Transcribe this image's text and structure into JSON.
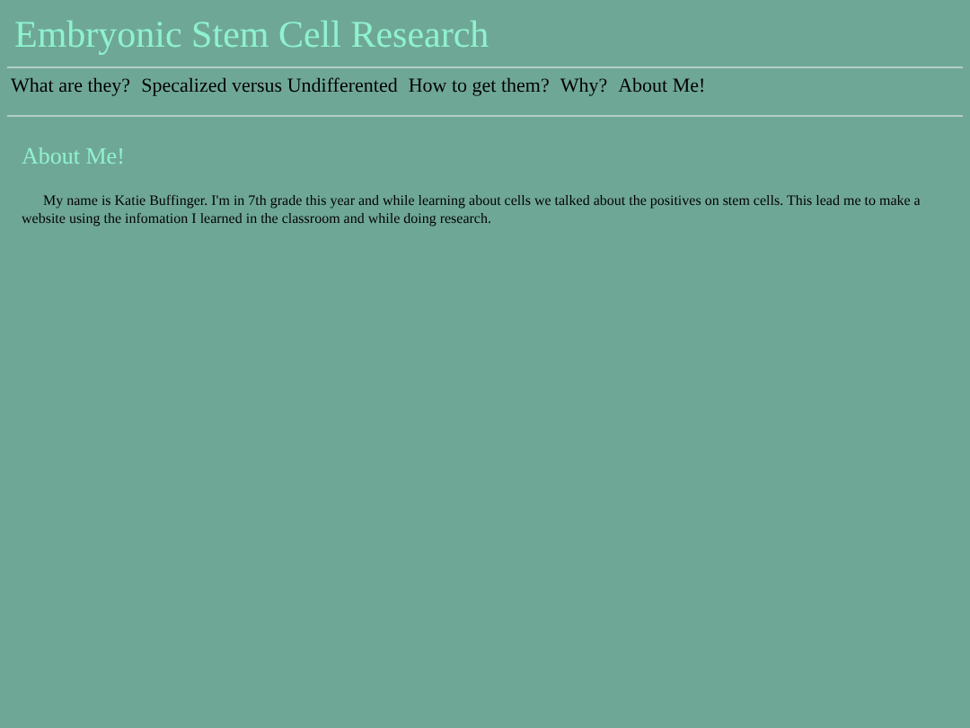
{
  "site_title": "Embryonic Stem Cell Research",
  "nav": [
    {
      "label": "What are they?"
    },
    {
      "label": "Specalized versus Undifferented"
    },
    {
      "label": "How to get them?"
    },
    {
      "label": "Why?"
    },
    {
      "label": "About Me!"
    }
  ],
  "section": {
    "heading": "About Me!",
    "body": "My name is Katie Buffinger. I'm in 7th grade this year and while learning about cells we talked about the positives on stem cells. This lead me to make a website using the infomation I learned in the classroom and while doing research."
  }
}
